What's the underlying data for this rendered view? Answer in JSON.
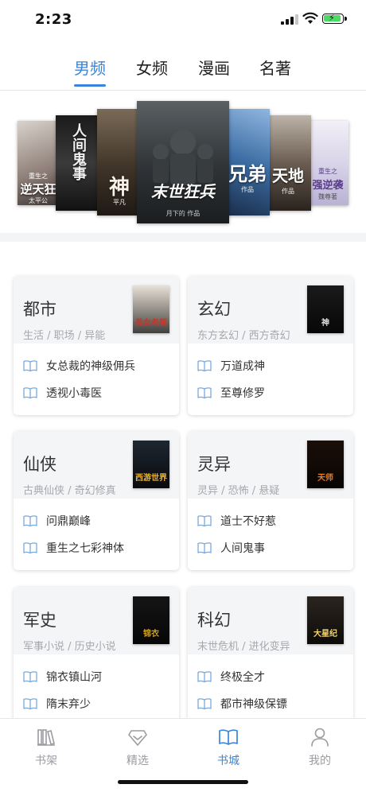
{
  "status_bar": {
    "time": "2:23"
  },
  "top_tabs": [
    {
      "label": "男频",
      "active": true
    },
    {
      "label": "女频",
      "active": false
    },
    {
      "label": "漫画",
      "active": false
    },
    {
      "label": "名著",
      "active": false
    }
  ],
  "carousel": {
    "covers": [
      {
        "title": "逆天狂",
        "subtitle": "重生之",
        "author": "太平公",
        "bg": "#c9c2bd"
      },
      {
        "title": "人间鬼事",
        "subtitle": "",
        "author": "",
        "bg": "#2a2a2a"
      },
      {
        "title": "神",
        "subtitle": "",
        "author": "平凡",
        "bg": "#5a4a3a"
      },
      {
        "title": "末世狂兵",
        "subtitle": "",
        "author": "月下的 作品",
        "bg": "#3b3f41"
      },
      {
        "title": "兄弟",
        "subtitle": "",
        "author": "作品",
        "bg": "#3c6da3"
      },
      {
        "title": "天地",
        "subtitle": "",
        "author": "作品",
        "bg": "#6b5d52"
      },
      {
        "title": "强逆袭",
        "subtitle": "重生之",
        "author": "魏尊著",
        "bg": "#d9d4e8"
      }
    ]
  },
  "categories": [
    {
      "title": "都市",
      "tags": "生活 / 职场 / 异能",
      "thumb_text": "美女老师",
      "thumb_bg": "#e8e0d6",
      "thumb_color": "#c0392b",
      "books": [
        "女总裁的神级佣兵",
        "透视小毒医"
      ]
    },
    {
      "title": "玄幻",
      "tags": "东方玄幻 / 西方奇幻",
      "thumb_text": "神",
      "thumb_bg": "#1a1a1a",
      "thumb_color": "#e0e0e0",
      "books": [
        "万道成神",
        "至尊修罗"
      ]
    },
    {
      "title": "仙侠",
      "tags": "古典仙侠 / 奇幻修真",
      "thumb_text": "西游世界",
      "thumb_bg": "#1e2630",
      "thumb_color": "#f0b429",
      "books": [
        "问鼎巅峰",
        "重生之七彩神体"
      ]
    },
    {
      "title": "灵异",
      "tags": "灵异 /  恐怖 / 悬疑",
      "thumb_text": "天师",
      "thumb_bg": "#1a0f08",
      "thumb_color": "#e67e22",
      "books": [
        "道士不好惹",
        "人间鬼事"
      ]
    },
    {
      "title": "军史",
      "tags": "军事小说 / 历史小说",
      "thumb_text": "锦衣",
      "thumb_bg": "#151515",
      "thumb_color": "#d4a017",
      "books": [
        "锦衣镇山河",
        "隋末弃少"
      ]
    },
    {
      "title": "科幻",
      "tags": "末世危机 / 进化变异",
      "thumb_text": "大星纪",
      "thumb_bg": "#2b2520",
      "thumb_color": "#f5d76e",
      "books": [
        "终极全才",
        "都市神级保镖"
      ]
    }
  ],
  "bottom_nav": [
    {
      "label": "书架",
      "icon": "bookshelf-icon",
      "active": false
    },
    {
      "label": "精选",
      "icon": "diamond-icon",
      "active": false
    },
    {
      "label": "书城",
      "icon": "book-icon",
      "active": true
    },
    {
      "label": "我的",
      "icon": "user-icon",
      "active": false
    }
  ],
  "colors": {
    "accent": "#3a85d9",
    "muted": "#9a9ca1"
  }
}
